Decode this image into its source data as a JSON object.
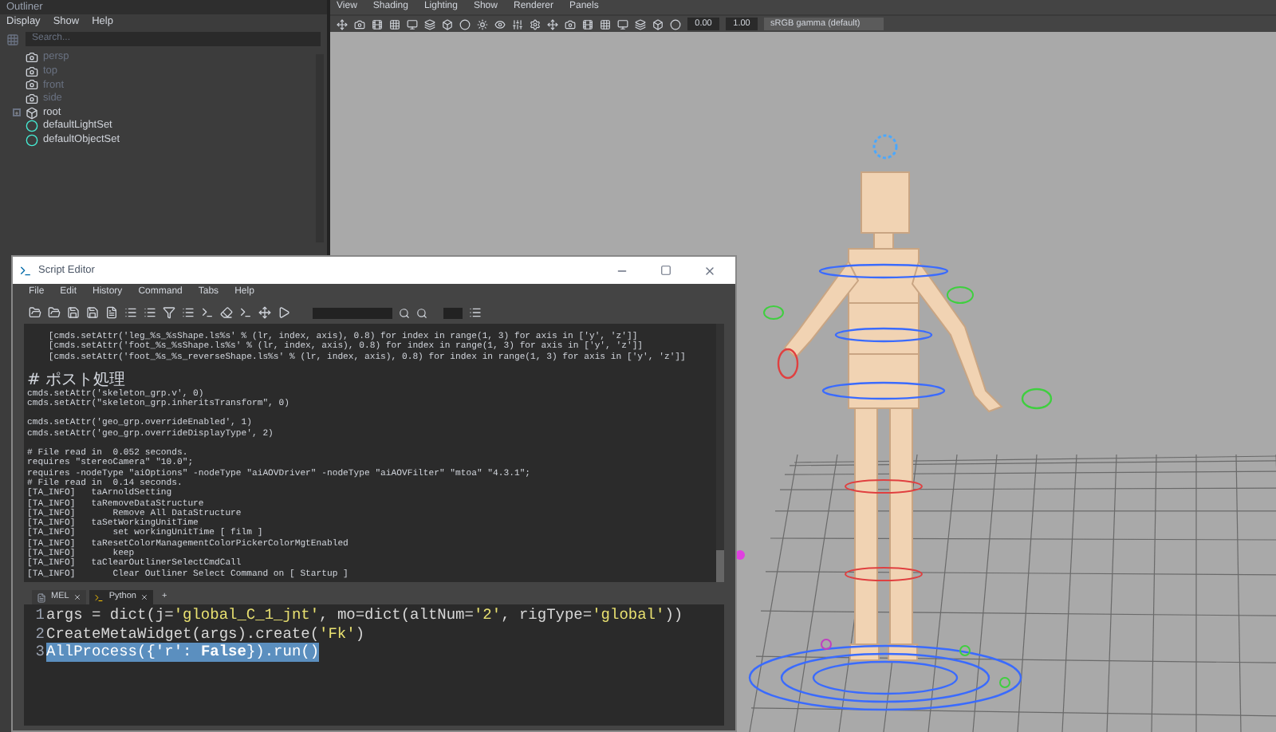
{
  "outliner": {
    "title": "Outliner",
    "menu": [
      "Display",
      "Show",
      "Help"
    ],
    "search": {
      "placeholder": "Search..."
    },
    "items": [
      {
        "kind": "camera",
        "label": "persp",
        "dimmed": true
      },
      {
        "kind": "camera",
        "label": "top",
        "dimmed": true
      },
      {
        "kind": "camera",
        "label": "front",
        "dimmed": true
      },
      {
        "kind": "camera",
        "label": "side",
        "dimmed": true
      },
      {
        "kind": "group",
        "label": "root",
        "dimmed": false,
        "expanded": false
      },
      {
        "kind": "set",
        "label": "defaultLightSet",
        "dimmed": false
      },
      {
        "kind": "set",
        "label": "defaultObjectSet",
        "dimmed": false
      }
    ]
  },
  "viewport": {
    "menu": [
      "View",
      "Shading",
      "Lighting",
      "Show",
      "Renderer",
      "Panels"
    ],
    "exposure": "0.00",
    "gamma": "1.00",
    "color_space": "sRGB gamma (default)"
  },
  "script_editor": {
    "title": "Script Editor",
    "menu": [
      "File",
      "Edit",
      "History",
      "Command",
      "Tabs",
      "Help"
    ],
    "history": [
      [
        "    [cmds.setAttr('leg_%s_%sShape.ls%s' % (lr, index, axis), 0.8) for index in range(1, 3) for axis in ['y', 'z']]",
        "    [cmds.setAttr('foot_%s_%sShape.ls%s' % (lr, index, axis), 0.8) for index in range(1, 3) for axis in ['y', 'z']]",
        "    [cmds.setAttr('foot_%s_%s_reverseShape.ls%s' % (lr, index, axis), 0.8) for index in range(1, 3) for axis in ['y', 'z']]"
      ],
      [
        "# ポスト処理",
        "cmds.setAttr('skeleton_grp.v', 0)",
        "cmds.setAttr(\"skeleton_grp.inheritsTransform\", 0)"
      ],
      [
        "cmds.setAttr('geo_grp.overrideEnabled', 1)",
        "cmds.setAttr('geo_grp.overrideDisplayType', 2)"
      ],
      [
        "# File read in  0.052 seconds.",
        "requires \"stereoCamera\" \"10.0\";",
        "requires -nodeType \"aiOptions\" -nodeType \"aiAOVDriver\" -nodeType \"aiAOVFilter\" \"mtoa\" \"4.3.1\";",
        "# File read in  0.14 seconds.",
        "[TA_INFO]   taArnoldSetting",
        "[TA_INFO]   taRemoveDataStructure",
        "[TA_INFO]       Remove All DataStructure",
        "[TA_INFO]   taSetWorkingUnitTime",
        "[TA_INFO]       set workingUnitTime [ film ]",
        "[TA_INFO]   taResetColorManagementColorPickerColorMgtEnabled",
        "[TA_INFO]       keep",
        "[TA_INFO]   taClearOutlinerSelectCmdCall",
        "[TA_INFO]       Clear Outliner Select Command on [ Startup ]"
      ]
    ],
    "tabs": [
      {
        "label": "MEL",
        "kind": "mel",
        "selected": false
      },
      {
        "label": "Python",
        "kind": "python",
        "selected": true
      }
    ],
    "add_tab": "+",
    "input": [
      {
        "number": "1",
        "selected": false,
        "segments": [
          {
            "kind": "plain",
            "text": "args = dict(j="
          },
          {
            "kind": "string",
            "text": "'global_C_1_jnt'"
          },
          {
            "kind": "plain",
            "text": ", mo=dict(altNum="
          },
          {
            "kind": "string",
            "text": "'2'"
          },
          {
            "kind": "plain",
            "text": ", rigType="
          },
          {
            "kind": "string",
            "text": "'global'"
          },
          {
            "kind": "plain",
            "text": "))"
          }
        ]
      },
      {
        "number": "2",
        "selected": false,
        "segments": [
          {
            "kind": "plain",
            "text": "CreateMetaWidget(args).create("
          },
          {
            "kind": "string",
            "text": "'Fk'"
          },
          {
            "kind": "plain",
            "text": ")"
          }
        ]
      },
      {
        "number": "3",
        "selected": true,
        "segments": [
          {
            "kind": "plain",
            "text": "AllProcess({"
          },
          {
            "kind": "string",
            "text": "'r'"
          },
          {
            "kind": "plain",
            "text": ": "
          },
          {
            "kind": "keyword",
            "text": "False"
          },
          {
            "kind": "plain",
            "text": "}).run()"
          }
        ]
      }
    ]
  }
}
